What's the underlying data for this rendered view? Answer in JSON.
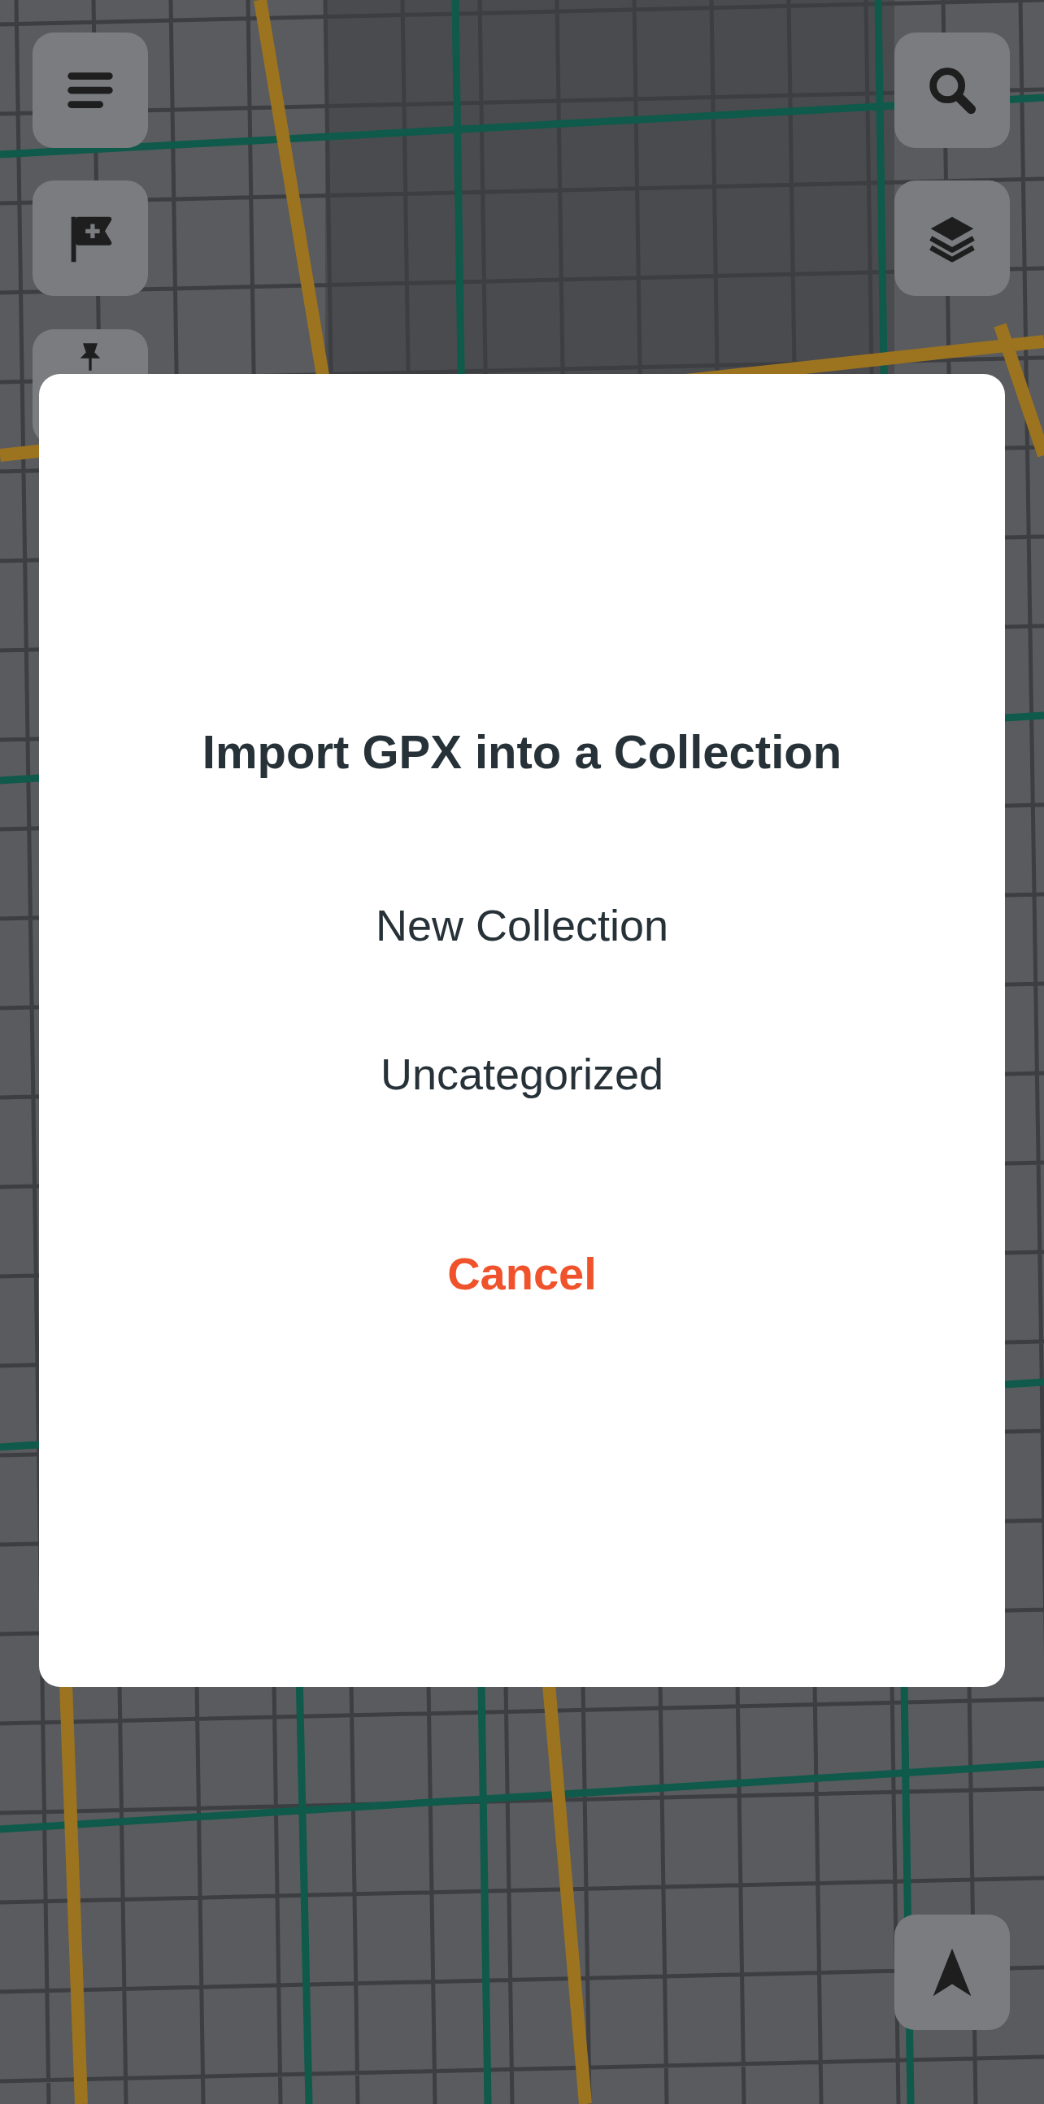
{
  "dialog": {
    "title": "Import GPX into a Collection",
    "options": [
      {
        "label": "New Collection"
      },
      {
        "label": "Uncategorized"
      }
    ],
    "cancel": "Cancel"
  }
}
